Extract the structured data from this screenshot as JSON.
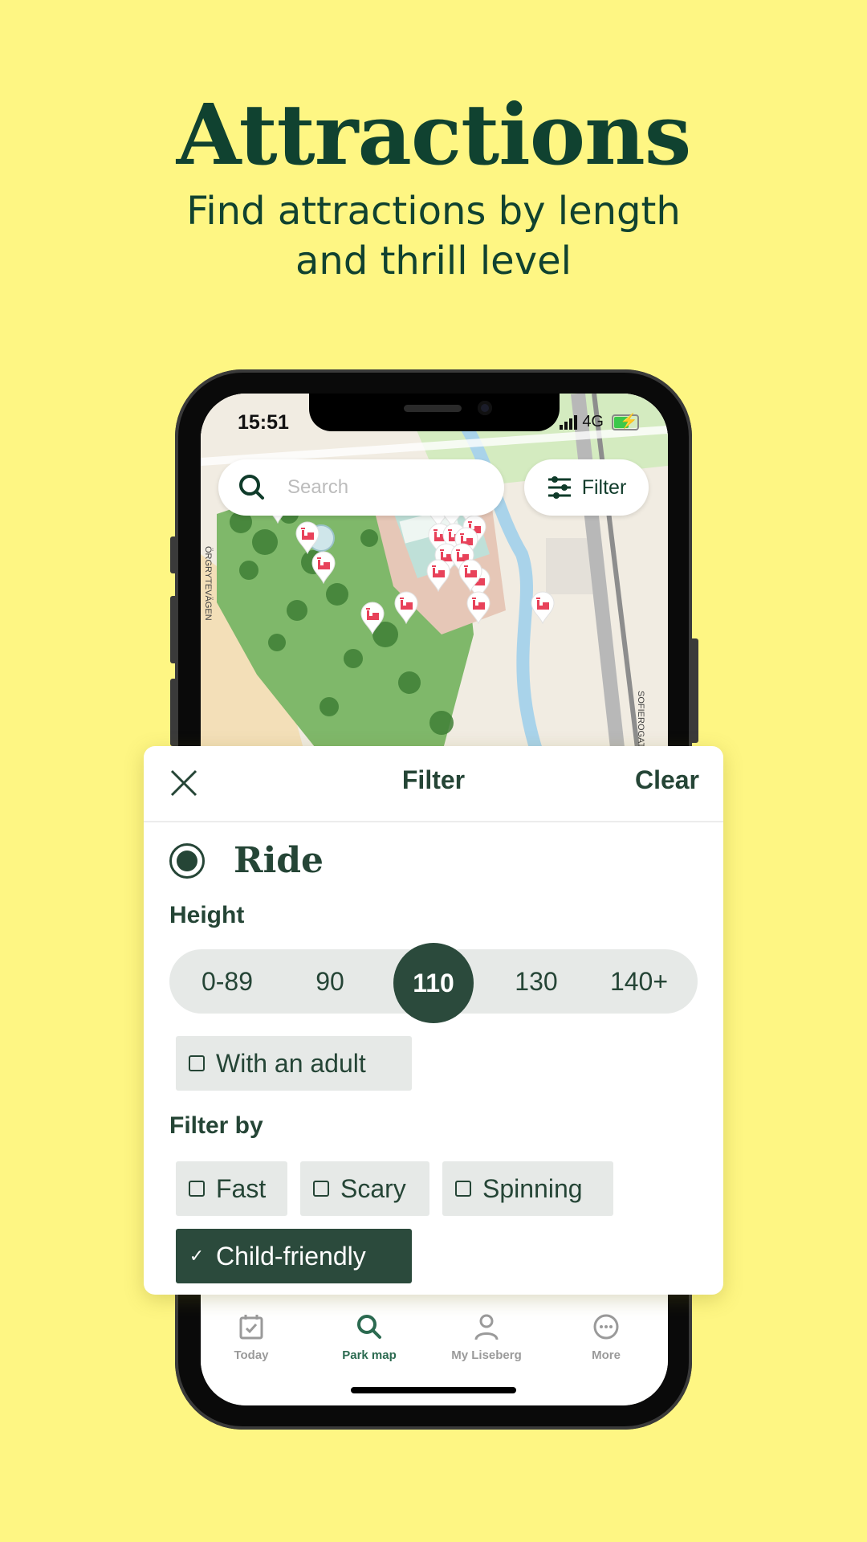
{
  "promo": {
    "title": "Attractions",
    "subtitle_line1": "Find attractions by length",
    "subtitle_line2": "and thrill level"
  },
  "status_bar": {
    "time": "15:51",
    "network": "4G",
    "battery_state": "charging"
  },
  "map": {
    "search_placeholder": "Search",
    "filter_button_label": "Filter",
    "street_labels": [
      "ÖRGRYTEVÄGEN",
      "SOFIEROGATAN"
    ],
    "marker_icon": "ride-icon",
    "marker_color": "#e8425a"
  },
  "filter_panel": {
    "title": "Filter",
    "clear_label": "Clear",
    "close_icon": "close-icon",
    "category": {
      "label": "Ride",
      "selected": true
    },
    "height": {
      "label": "Height",
      "options": [
        "0-89",
        "90",
        "110",
        "130",
        "140+"
      ],
      "selected": "110"
    },
    "with_adult": {
      "label": "With an adult",
      "checked": false
    },
    "filter_by": {
      "label": "Filter by",
      "options": [
        {
          "label": "Fast",
          "checked": false
        },
        {
          "label": "Scary",
          "checked": false
        },
        {
          "label": "Spinning",
          "checked": false
        },
        {
          "label": "Child-friendly",
          "checked": true
        }
      ]
    }
  },
  "tab_bar": {
    "items": [
      {
        "label": "Today",
        "icon": "calendar-check-icon",
        "active": false
      },
      {
        "label": "Park map",
        "icon": "search-icon",
        "active": true
      },
      {
        "label": "My Liseberg",
        "icon": "person-icon",
        "active": false
      },
      {
        "label": "More",
        "icon": "more-icon",
        "active": false
      }
    ]
  },
  "colors": {
    "background": "#fef683",
    "brand_dark_green": "#104230",
    "panel_text": "#254536",
    "selected_fill": "#2b4a3c",
    "active_tab": "#2b6a50"
  }
}
